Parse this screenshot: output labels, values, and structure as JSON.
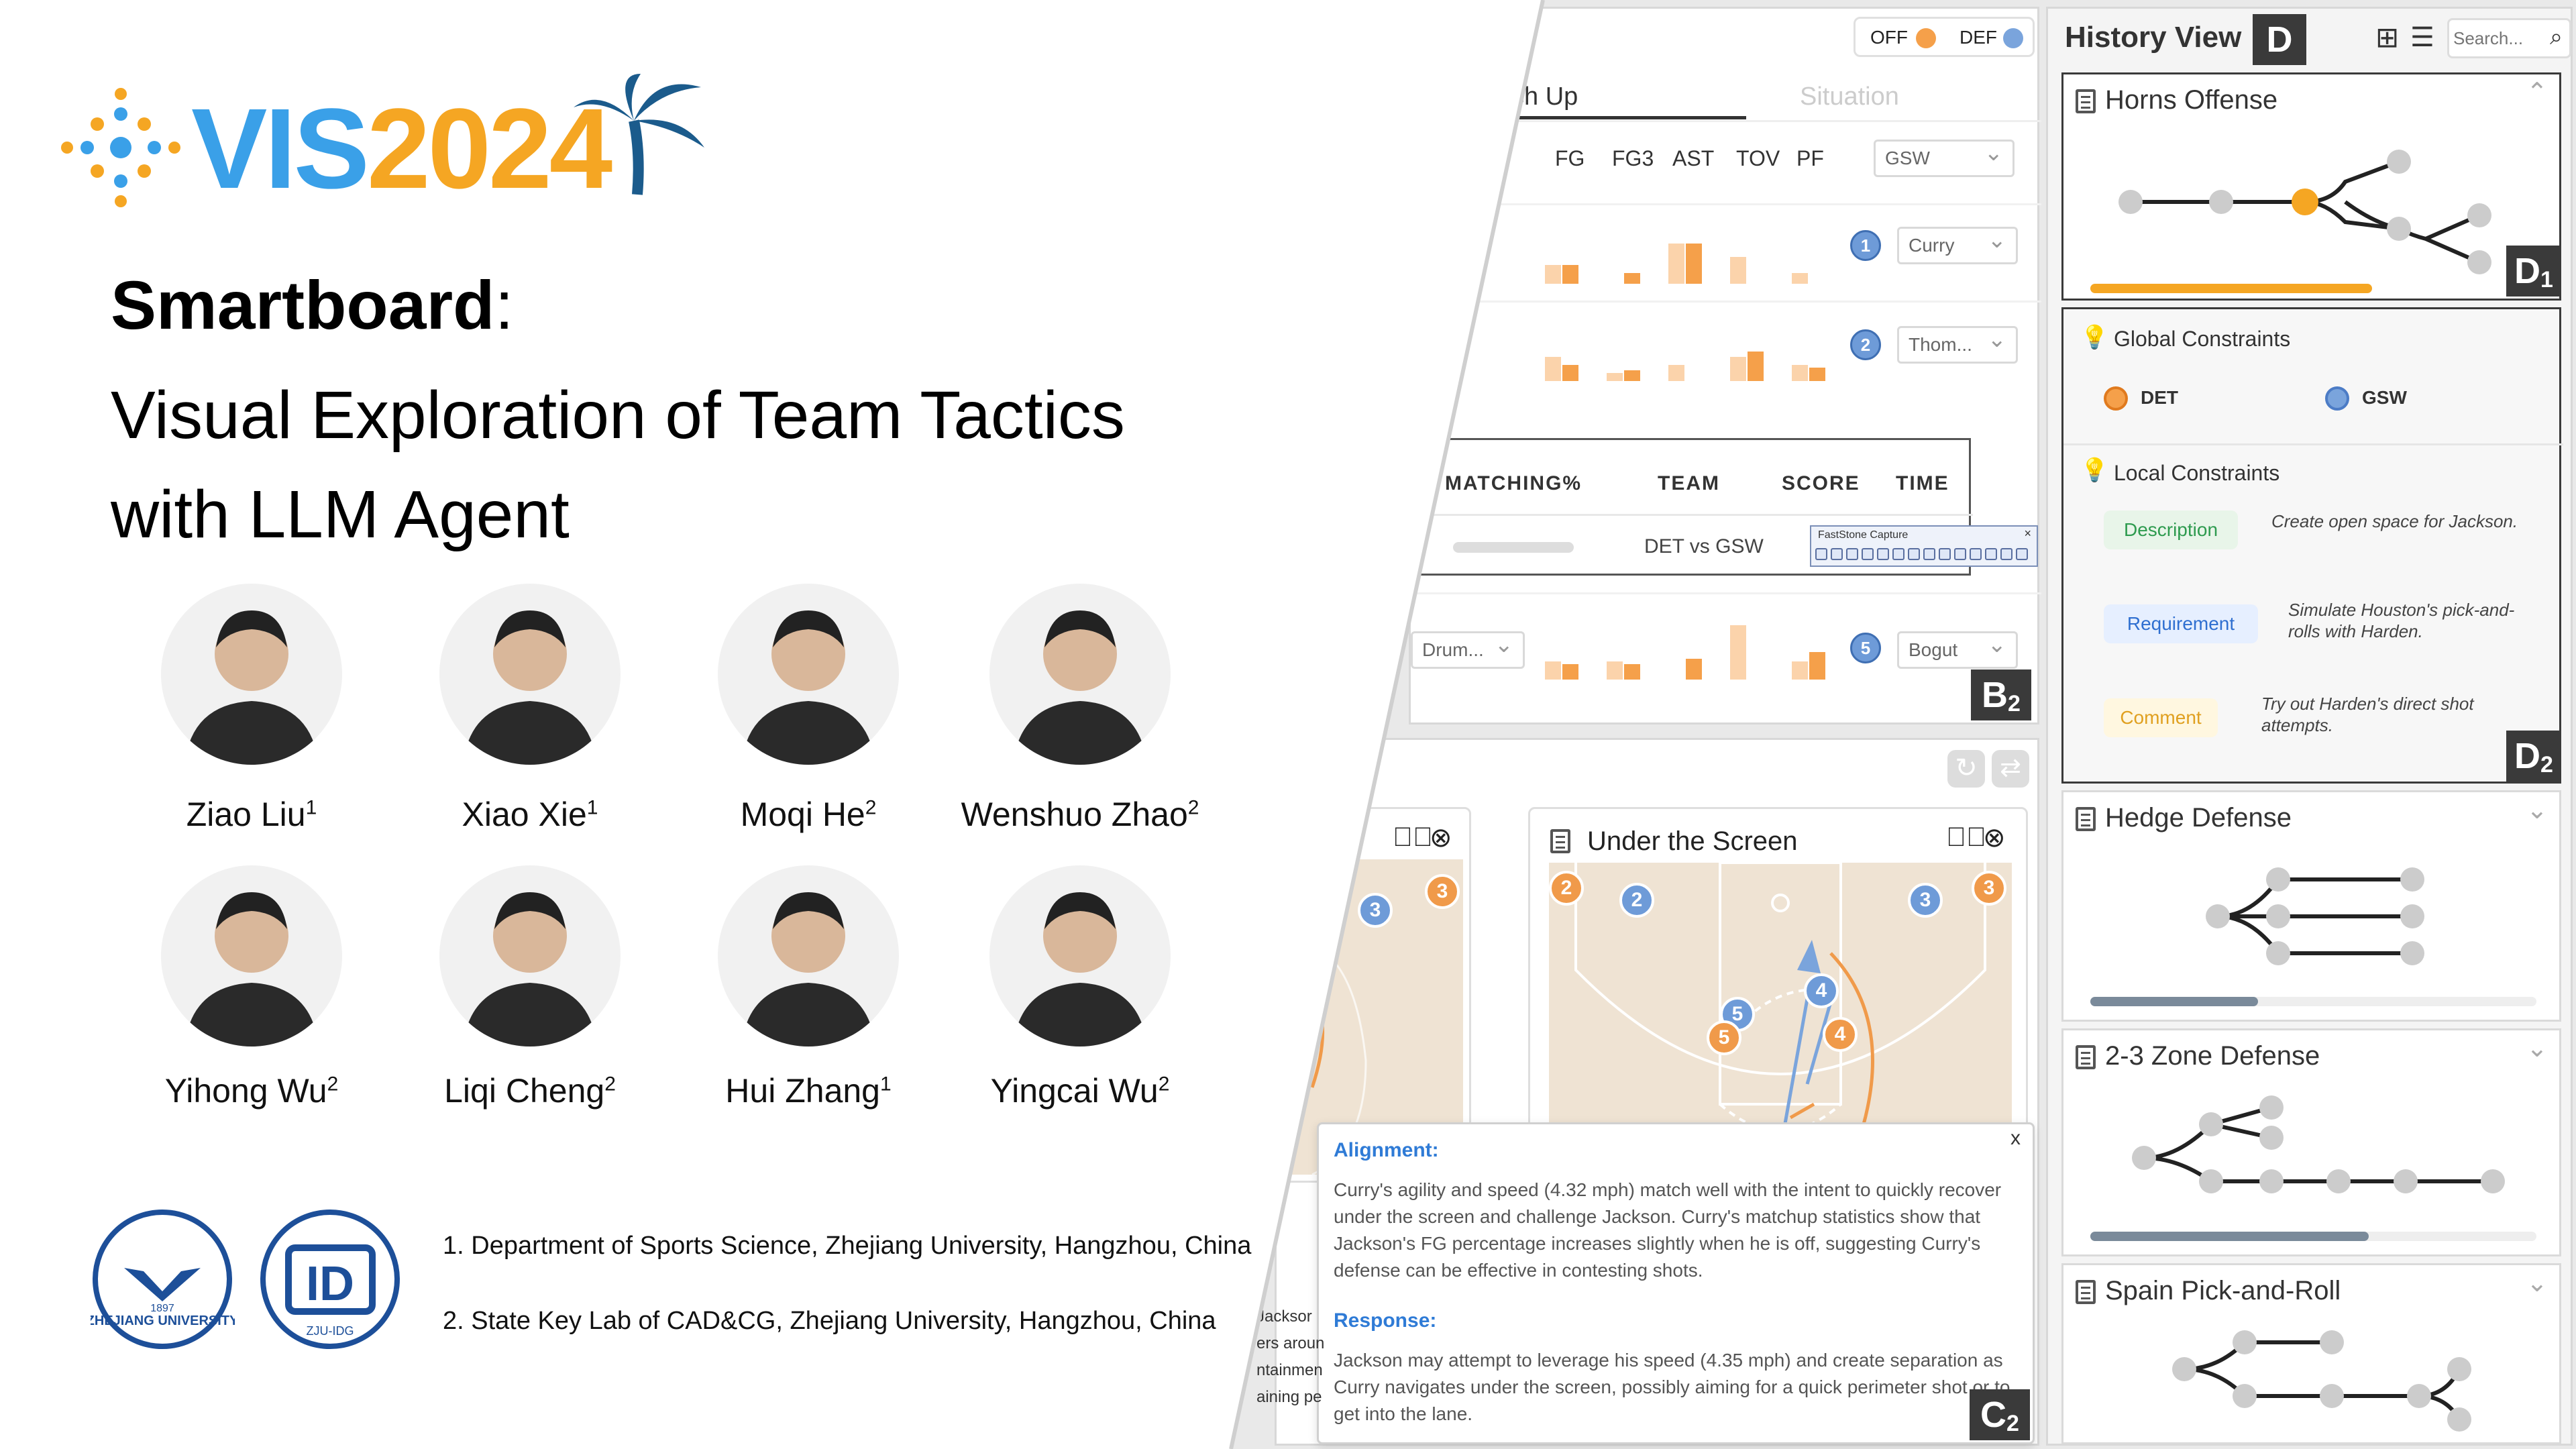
{
  "header": {
    "off_label": "OFF",
    "def_label": "DEF",
    "off_color": "#f5a04a",
    "def_color": "#7aa4dc"
  },
  "tabs": {
    "match_up": "ch Up",
    "situation": "Situation"
  },
  "stats": {
    "columns": [
      "FG",
      "FG3",
      "AST",
      "TOV",
      "PF"
    ],
    "team_select": "GSW",
    "rows": [
      {
        "num": "1",
        "player": "Curry",
        "left": ""
      },
      {
        "num": "2",
        "player": "Thom...",
        "left": ""
      },
      {
        "num": "5",
        "player": "Bogut",
        "left": "Drum..."
      }
    ]
  },
  "popup": {
    "columns": [
      "MATCHING%",
      "TEAM",
      "SCORE",
      "TIME"
    ],
    "team": "DET vs GSW",
    "capture_title": "FastStone Capture"
  },
  "tags": {
    "b2": "B",
    "b2_sub": "2",
    "c2": "C",
    "c2_sub": "2",
    "d": "D",
    "d1": "D",
    "d1_sub": "1",
    "d2": "D",
    "d2_sub": "2"
  },
  "tactic_card": {
    "title": "Under the Screen",
    "left_text": [
      "Jacksor",
      "ers aroun",
      "ntainmen",
      "aining pe"
    ]
  },
  "explanation": {
    "alignment_label": "Alignment:",
    "alignment_text": "Curry's agility and speed (4.32 mph) match well with the intent to quickly recover under the screen and challenge Jackson. Curry's matchup statistics show that Jackson's FG percentage increases slightly when he is off, suggesting Curry's defense can be effective in contesting shots.",
    "response_label": "Response:",
    "response_text": "Jackson may attempt to leverage his speed (4.35 mph) and create separation as Curry navigates under the screen, possibly aiming for a quick perimeter shot or to get into the lane.",
    "close": "x"
  },
  "history": {
    "title": "History View",
    "search_placeholder": "Search...",
    "cards": [
      {
        "title": "Horns Offense"
      },
      {
        "title": "Hedge Defense"
      },
      {
        "title": "2-3 Zone Defense"
      },
      {
        "title": "Spain Pick-and-Roll"
      }
    ],
    "global_label": "Global Constraints",
    "team_a": "DET",
    "team_b": "GSW",
    "local_label": "Local Constraints",
    "constraints": [
      {
        "kind": "Description",
        "text": "Create open space for Jackson."
      },
      {
        "kind": "Requirement",
        "text": "Simulate Houston's pick-and-rolls with Harden."
      },
      {
        "kind": "Comment",
        "text": "Try out Harden's direct shot attempts."
      }
    ]
  },
  "poster": {
    "logo_vis": "VIS",
    "logo_year": "2024",
    "title_bold": "Smartboard",
    "title_colon": ":",
    "subtitle_line1": "Visual Exploration of Team Tactics",
    "subtitle_line2": "with LLM Agent",
    "authors": [
      {
        "name": "Ziao Liu",
        "aff": "1"
      },
      {
        "name": "Xiao Xie",
        "aff": "1"
      },
      {
        "name": "Moqi He",
        "aff": "2"
      },
      {
        "name": "Wenshuo Zhao",
        "aff": "2"
      },
      {
        "name": "Yihong Wu",
        "aff": "2"
      },
      {
        "name": "Liqi Cheng",
        "aff": "2"
      },
      {
        "name": "Hui Zhang",
        "aff": "1"
      },
      {
        "name": "Yingcai Wu",
        "aff": "2"
      }
    ],
    "affiliations": [
      "1. Department of Sports Science, Zhejiang University, Hangzhou, China",
      "2. State Key Lab of CAD&CG, Zhejiang University, Hangzhou, China"
    ],
    "zju_text": "ZHEJIANG UNIVERSITY",
    "zju_year": "1897",
    "idg_text": "ID",
    "idg_caption": "ZJU-IDG"
  }
}
